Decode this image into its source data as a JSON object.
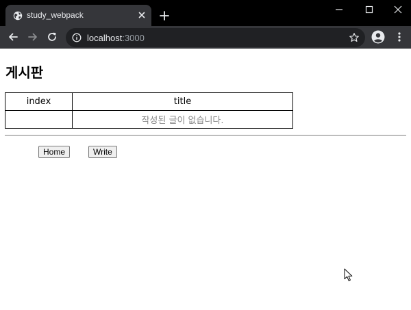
{
  "browser": {
    "tab_title": "study_webpack",
    "url_host": "localhost",
    "url_port": ":3000",
    "icons": {
      "favicon": "globe-icon",
      "tab_close": "close-icon",
      "new_tab": "plus-icon",
      "minimize": "minimize-icon",
      "maximize": "maximize-icon",
      "close_window": "close-icon",
      "back": "arrow-left-icon",
      "forward": "arrow-right-icon",
      "reload": "reload-icon",
      "site_info": "info-icon",
      "bookmark": "star-icon",
      "profile": "account-icon",
      "menu": "kebab-menu-icon"
    },
    "colors": {
      "titlebar": "#000000",
      "toolbar": "#35363a",
      "omnibox": "#202124"
    }
  },
  "page": {
    "title": "게시판",
    "table": {
      "headers": [
        "index",
        "title"
      ],
      "empty_message": "작성된 글이 없습니다."
    },
    "nav": {
      "home_label": "Home",
      "write_label": "Write"
    }
  }
}
